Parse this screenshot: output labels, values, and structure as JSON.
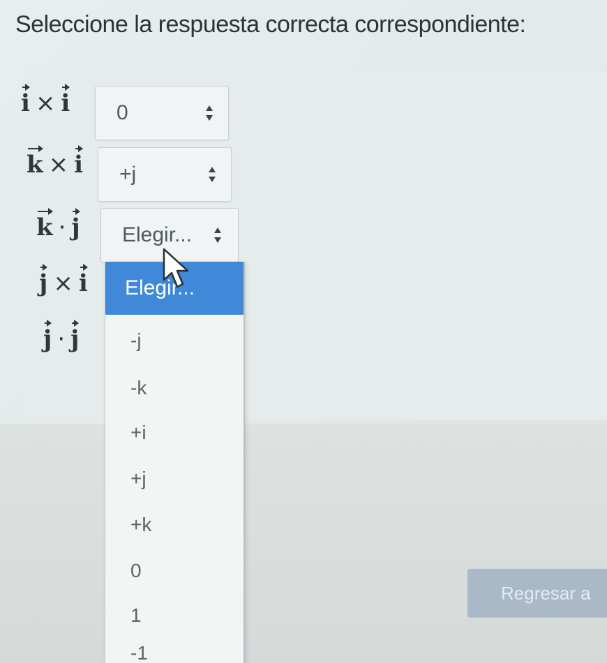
{
  "question": {
    "prompt": "Seleccione la respuesta correcta correspondiente:"
  },
  "rows": [
    {
      "left": "i",
      "operator": "×",
      "right": "i",
      "selected": "0"
    },
    {
      "left": "k",
      "operator": "×",
      "right": "i",
      "selected": "+j"
    },
    {
      "left": "k",
      "operator": "·",
      "right": "j",
      "selected": "Elegir..."
    },
    {
      "left": "j",
      "operator": "×",
      "right": "i",
      "selected": ""
    },
    {
      "left": "j",
      "operator": "·",
      "right": "j",
      "selected": ""
    }
  ],
  "dropdown": {
    "options": [
      "Elegir...",
      "-j",
      "-k",
      "+i",
      "+j",
      "+k",
      "0",
      "1",
      "-1"
    ],
    "highlighted_index": 0
  },
  "buttons": {
    "return_label": "Regresar a"
  },
  "colors": {
    "highlight": "#3f89d8",
    "button": "#a9b9c7"
  },
  "icons": {
    "select_arrows": "up-down-arrows-icon",
    "cursor": "mouse-pointer-icon"
  }
}
